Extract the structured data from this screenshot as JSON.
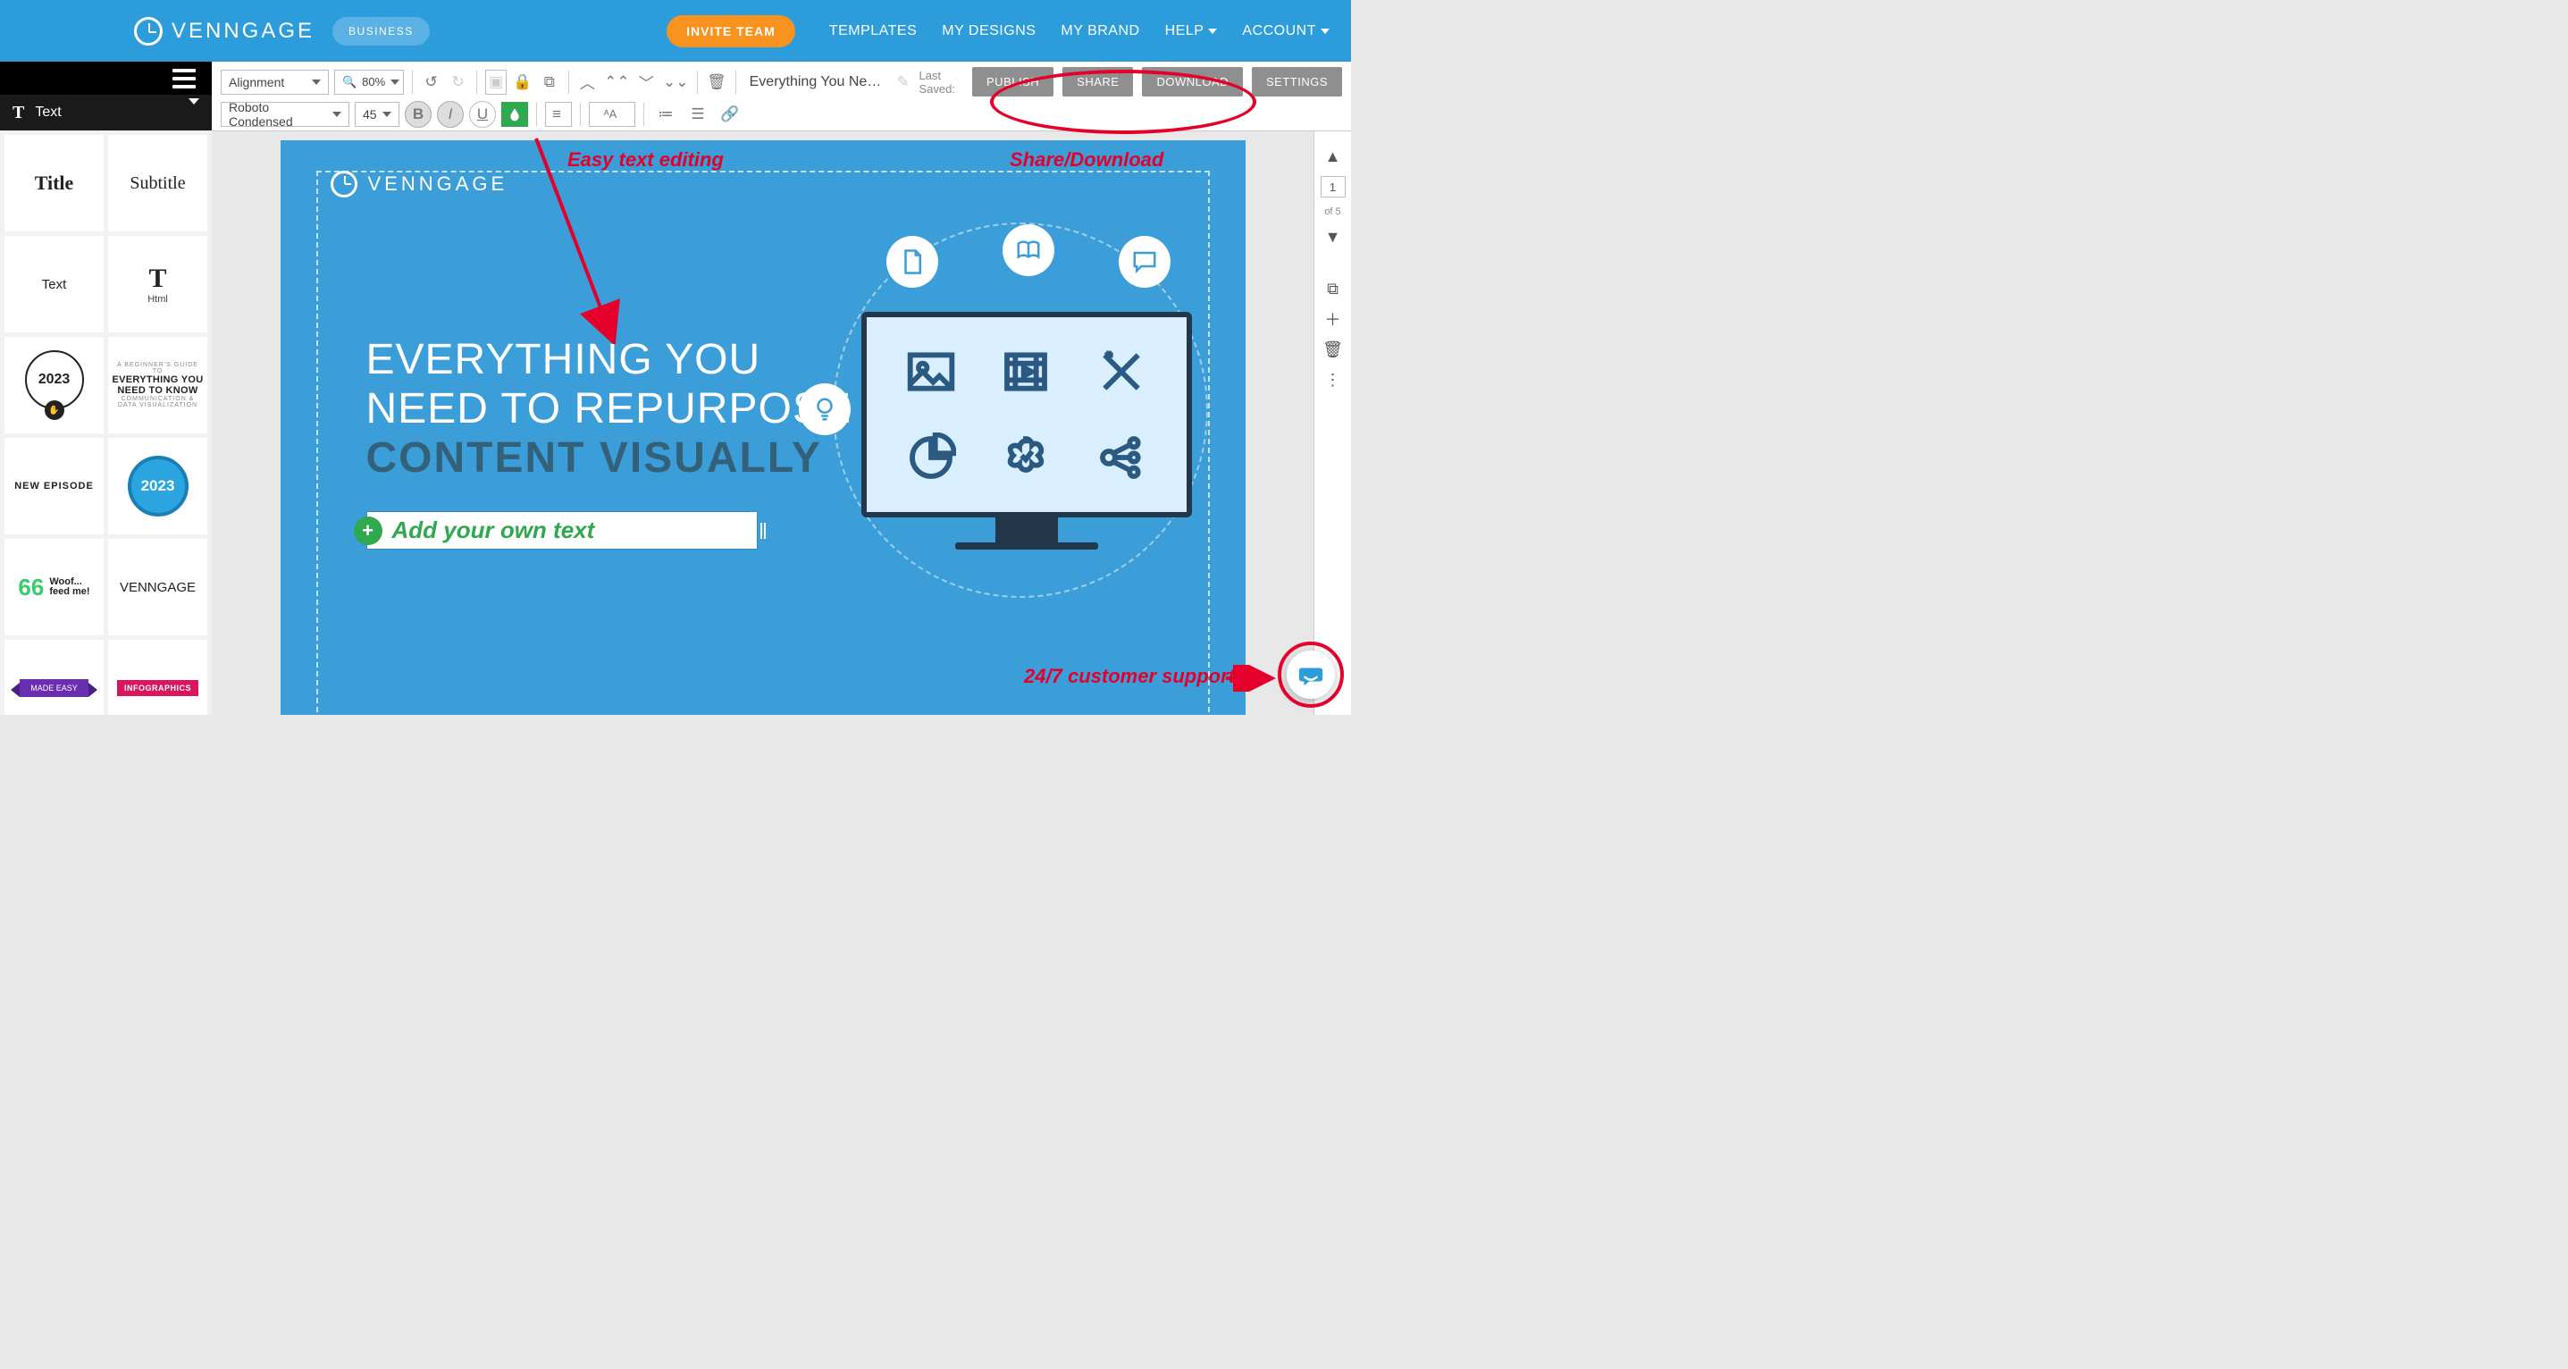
{
  "navbar": {
    "brand": "VENNGAGE",
    "badge": "BUSINESS",
    "invite": "INVITE TEAM",
    "links": [
      "TEMPLATES",
      "MY DESIGNS",
      "MY BRAND",
      "HELP",
      "ACCOUNT"
    ],
    "links_with_caret": [
      false,
      false,
      false,
      true,
      true
    ]
  },
  "sidebar": {
    "section_label": "Text",
    "tiles": {
      "title": "Title",
      "subtitle": "Subtitle",
      "text": "Text",
      "html_label": "Html",
      "year": "2023",
      "know_top": "A BEGINNER'S GUIDE TO",
      "know_line": "EVERYTHING YOU NEED TO KNOW",
      "know_sub": "COMMUNICATION & DATA VISUALIZATION",
      "new_episode": "NEW EPISODE",
      "blue_year": "2023",
      "woof_quote": "66",
      "woof_text1": "Woof...",
      "woof_text2": "feed me!",
      "venn_l1": "VENN",
      "venn_l2": "GAGE",
      "made_easy": "MADE EASY",
      "infographics": "INFOGRAPHICS"
    }
  },
  "toolbar": {
    "alignment": "Alignment",
    "zoom": "80%",
    "font": "Roboto Condensed",
    "font_size": "45",
    "doc_title": "Everything You Need ...",
    "last_saved_label": "Last Saved:",
    "actions": {
      "publish": "PUBLISH",
      "share": "SHARE",
      "download": "DOWNLOAD",
      "settings": "SETTINGS"
    }
  },
  "canvas": {
    "brand": "VENNGAGE",
    "headline_l1": "EVERYTHING YOU",
    "headline_l2": "NEED TO REPURPOSE",
    "headline_l3": "CONTENT VISUALLY",
    "add_text_placeholder": "Add your own text"
  },
  "rail": {
    "page": "1",
    "of": "of 5"
  },
  "annotations": {
    "easy_text": "Easy text editing",
    "share_dl": "Share/Download",
    "support": "24/7 customer support"
  }
}
